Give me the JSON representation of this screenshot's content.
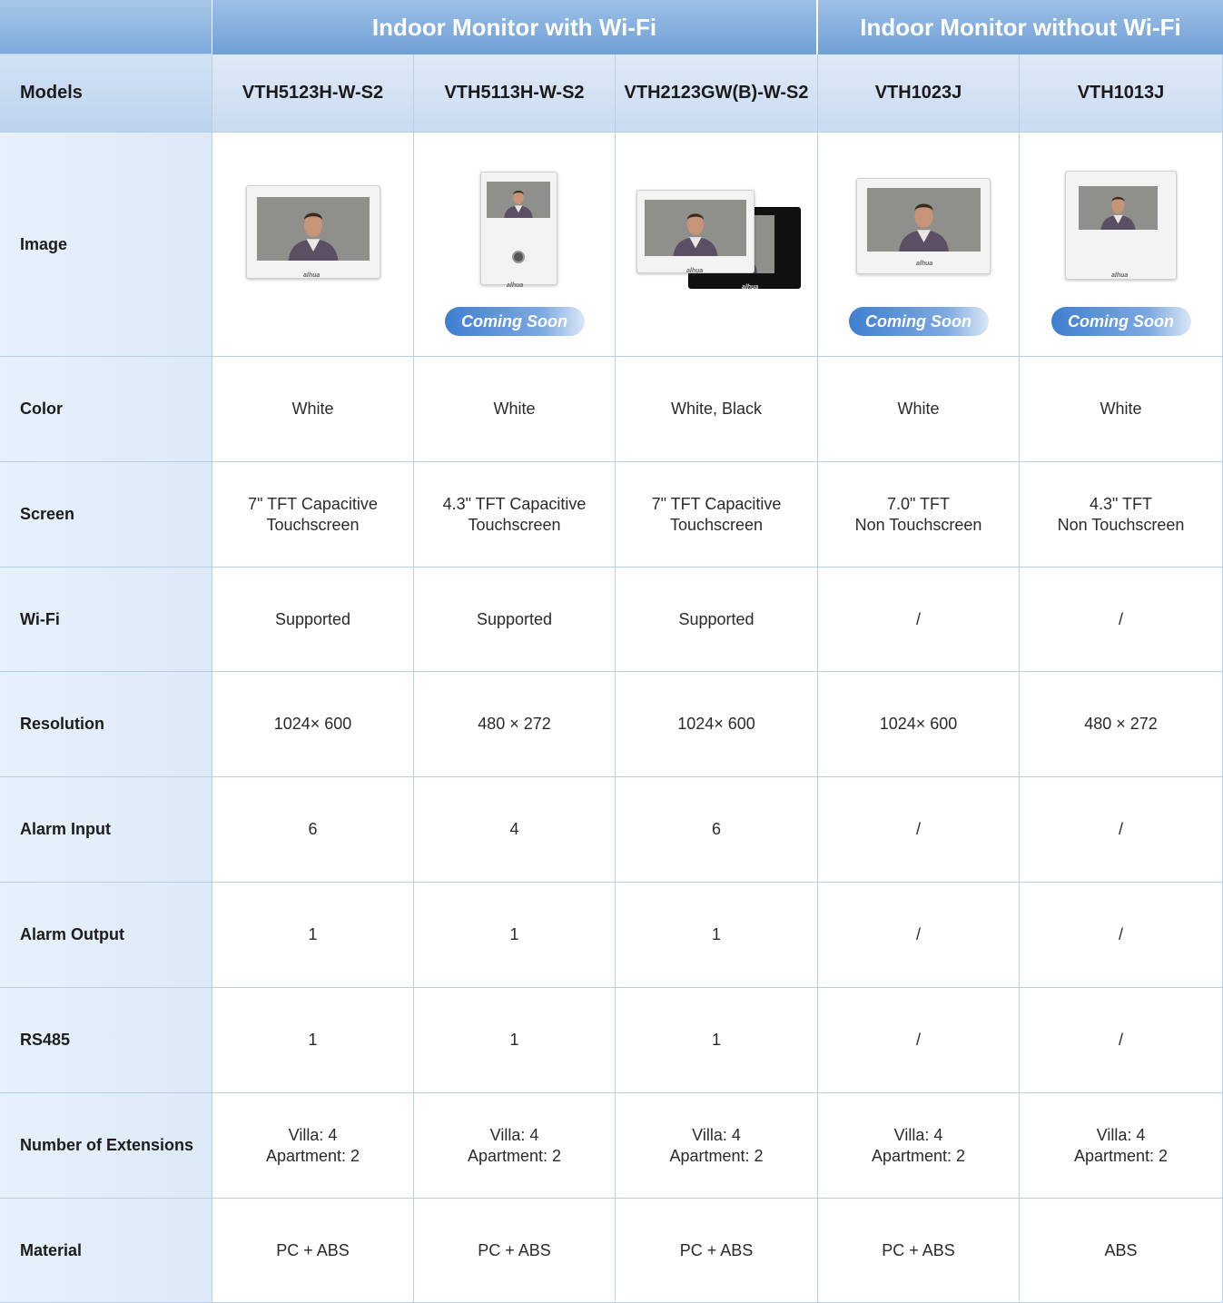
{
  "header": {
    "group_wifi": "Indoor Monitor with Wi-Fi",
    "group_nowifi": "Indoor Monitor without Wi-Fi",
    "models_label": "Models"
  },
  "labels": {
    "image": "Image",
    "color": "Color",
    "screen": "Screen",
    "wifi": "Wi-Fi",
    "resolution": "Resolution",
    "alarm_input": "Alarm Input",
    "alarm_output": "Alarm Output",
    "rs485": "RS485",
    "extensions": "Number of Extensions",
    "material": "Material"
  },
  "badge_text": "Coming Soon",
  "logo_text": "alhua",
  "models": [
    {
      "name": "VTH5123H-W-S2",
      "coming_soon": false,
      "color": "White",
      "screen": "7\" TFT Capacitive\nTouchscreen",
      "wifi": "Supported",
      "resolution": "1024× 600",
      "alarm_input": "6",
      "alarm_output": "1",
      "rs485": "1",
      "extensions": "Villa: 4\nApartment: 2",
      "material": "PC + ABS"
    },
    {
      "name": "VTH5113H-W-S2",
      "coming_soon": true,
      "color": "White",
      "screen": "4.3\" TFT Capacitive\nTouchscreen",
      "wifi": "Supported",
      "resolution": "480 × 272",
      "alarm_input": "4",
      "alarm_output": "1",
      "rs485": "1",
      "extensions": "Villa: 4\nApartment: 2",
      "material": "PC + ABS"
    },
    {
      "name": "VTH2123GW(B)-W-S2",
      "coming_soon": false,
      "color": "White, Black",
      "screen": "7\" TFT Capacitive\nTouchscreen",
      "wifi": "Supported",
      "resolution": "1024× 600",
      "alarm_input": "6",
      "alarm_output": "1",
      "rs485": "1",
      "extensions": "Villa: 4\nApartment: 2",
      "material": "PC + ABS"
    },
    {
      "name": "VTH1023J",
      "coming_soon": true,
      "color": "White",
      "screen": "7.0\" TFT\nNon Touchscreen",
      "wifi": "/",
      "resolution": "1024× 600",
      "alarm_input": "/",
      "alarm_output": "/",
      "rs485": "/",
      "extensions": "Villa: 4\nApartment: 2",
      "material": "PC + ABS"
    },
    {
      "name": "VTH1013J",
      "coming_soon": true,
      "color": "White",
      "screen": "4.3\" TFT\nNon Touchscreen",
      "wifi": "/",
      "resolution": "480 × 272",
      "alarm_input": "/",
      "alarm_output": "/",
      "rs485": "/",
      "extensions": "Villa: 4\nApartment: 2",
      "material": "ABS"
    }
  ]
}
